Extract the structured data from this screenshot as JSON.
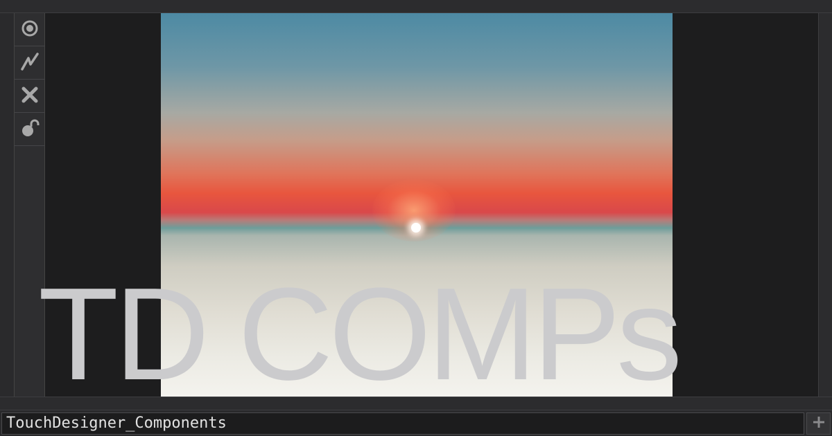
{
  "viewer": {
    "title_overlay": "TD COMPs"
  },
  "toolbar": {
    "items": [
      {
        "icon": "view-icon"
      },
      {
        "icon": "pulse-icon"
      },
      {
        "icon": "close-icon"
      },
      {
        "icon": "unlock-icon"
      }
    ]
  },
  "path_field": {
    "value": "TouchDesigner_Components"
  },
  "add_button": {
    "icon": "plus-icon"
  },
  "colors": {
    "background": "#2a2a2c",
    "viewer_bg": "#1d1d1e",
    "text": "#cbcbcd",
    "icon": "#a8a8a8"
  }
}
